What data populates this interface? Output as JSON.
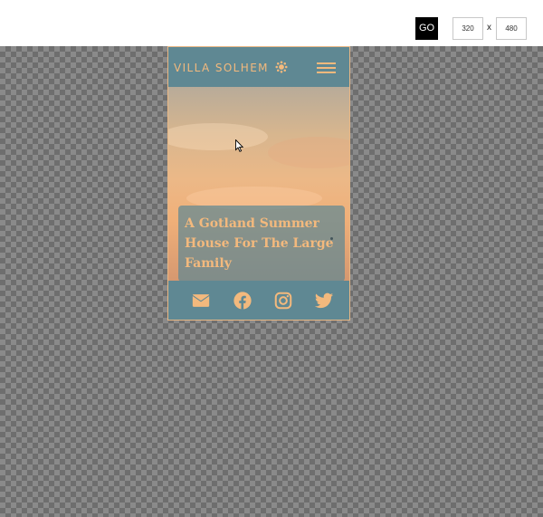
{
  "toolbar": {
    "go_label": "GO",
    "width_value": "320",
    "height_value": "480",
    "separator": "x"
  },
  "site": {
    "brand": "VILLA SOLHEM",
    "brand_icon": "sun-icon",
    "menu_icon": "hamburger-menu-icon"
  },
  "hero": {
    "title": "A Gotland Summer House For The Large Family"
  },
  "footer": {
    "icons": [
      "envelope-icon",
      "facebook-icon",
      "instagram-icon",
      "twitter-icon"
    ]
  },
  "colors": {
    "brand_teal": "#5f8893",
    "accent_orange": "#f3b97d",
    "frame_border": "#e9b784"
  }
}
